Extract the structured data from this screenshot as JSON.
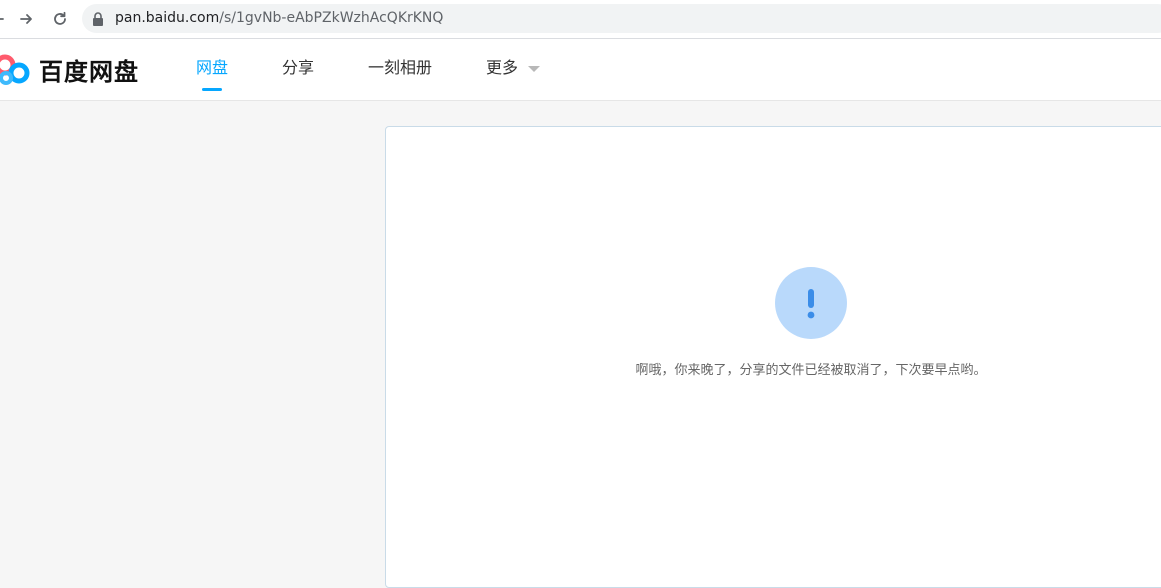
{
  "browser": {
    "url_host": "pan.baidu.com",
    "url_path": "/s/1gvNb-eAbPZkWzhAcQKrKNQ"
  },
  "header": {
    "logo_text": "百度网盘",
    "nav": {
      "wangpan": "网盘",
      "share": "分享",
      "album": "一刻相册",
      "more": "更多"
    },
    "active_nav": "网盘",
    "accent_color": "#06a7ff"
  },
  "notice": {
    "icon": "exclamation-icon",
    "icon_bg_color": "#b9d9fb",
    "icon_color": "#3b8de8",
    "message": "啊哦，你来晚了，分享的文件已经被取消了，下次要早点哟。"
  }
}
